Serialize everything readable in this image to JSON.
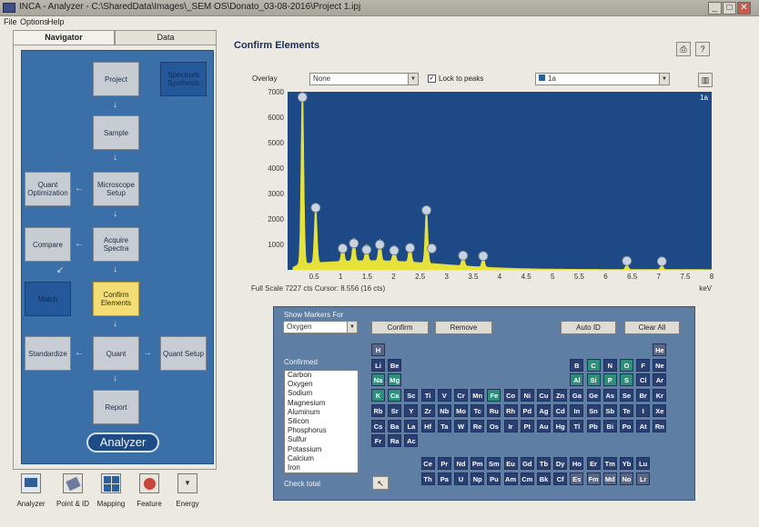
{
  "window": {
    "title": "INCA - Analyzer - C:\\SharedData\\Images\\_SEM OS\\Donato_03-08-2016\\Project 1.ipj"
  },
  "menu": [
    "File",
    "Options",
    "Help"
  ],
  "nav": {
    "tabs": [
      "Navigator",
      "Data"
    ],
    "boxes": {
      "project": "Project",
      "spectrum_synthesis": "Spectrum Synthesis",
      "sample": "Sample",
      "quant_optimization": "Quant Optimization",
      "microscope_setup": "Microscope Setup",
      "compare": "Compare",
      "acquire_spectra": "Acquire Spectra",
      "match": "Match",
      "confirm_elements": "Confirm Elements",
      "standardize": "Standardize",
      "quant": "Quant",
      "quant_setup": "Quant Setup",
      "report": "Report"
    },
    "analyzer_button": "Analyzer"
  },
  "toolbar": [
    {
      "label": "Analyzer",
      "icon": "analyzer-icon"
    },
    {
      "label": "Point & ID",
      "icon": "point-id-icon"
    },
    {
      "label": "Mapping",
      "icon": "mapping-icon"
    },
    {
      "label": "Feature",
      "icon": "feature-icon"
    },
    {
      "label": "Energy",
      "icon": "energy-icon"
    }
  ],
  "main": {
    "title": "Confirm Elements",
    "overlay_label": "Overlay",
    "overlay_value": "None",
    "lock_to_peaks": "Lock to peaks",
    "lock_checked": true,
    "spectrum_select": "1a",
    "spectrum_name": "1a",
    "full_scale": "Full Scale 7227 cts Cursor: 8.556 (16 cts)"
  },
  "chart_data": {
    "type": "line",
    "xlabel": "keV",
    "ylim": [
      0,
      7000
    ],
    "xlim": [
      0,
      8
    ],
    "yticks": [
      1000,
      2000,
      3000,
      4000,
      5000,
      6000,
      7000
    ],
    "xticks": [
      "0.5",
      "1",
      "1.5",
      "2",
      "2.5",
      "3",
      "3.5",
      "4",
      "4.5",
      "5",
      "5.5",
      "6",
      "6.5",
      "7",
      "7.5",
      "8"
    ],
    "peaks": [
      {
        "x": 0.28,
        "y": 7227
      },
      {
        "x": 0.53,
        "y": 2300
      },
      {
        "x": 1.04,
        "y": 700
      },
      {
        "x": 1.25,
        "y": 900
      },
      {
        "x": 1.49,
        "y": 650
      },
      {
        "x": 1.74,
        "y": 850
      },
      {
        "x": 2.01,
        "y": 620
      },
      {
        "x": 2.31,
        "y": 720
      },
      {
        "x": 2.62,
        "y": 2200
      },
      {
        "x": 3.31,
        "y": 420
      },
      {
        "x": 3.69,
        "y": 400
      },
      {
        "x": 6.4,
        "y": 210
      },
      {
        "x": 7.06,
        "y": 190
      }
    ],
    "markers": [
      0.28,
      0.53,
      1.04,
      1.25,
      1.49,
      1.74,
      2.01,
      2.31,
      2.62,
      2.72,
      3.31,
      3.69,
      6.4,
      7.06
    ],
    "color": "#e6e23a",
    "background": "#1d4a86"
  },
  "picker": {
    "show_markers_for": "Show Markers For",
    "element_select": "Oxygen",
    "confirm": "Confirm",
    "remove": "Remove",
    "auto_id": "Auto ID",
    "clear_all": "Clear All",
    "confirmed_label": "Confirmed",
    "confirmed": [
      "Carbon",
      "Oxygen",
      "Sodium",
      "Magnesium",
      "Aluminum",
      "Silicon",
      "Phosphorus",
      "Sulfur",
      "Potassium",
      "Calcium",
      "Iron"
    ],
    "check_total": "Check total",
    "periodic_rows": [
      [
        "H",
        "",
        "",
        "",
        "",
        "",
        "",
        "",
        "",
        "",
        "",
        "",
        "",
        "",
        "",
        "",
        "",
        "He"
      ],
      [
        "Li",
        "Be",
        "",
        "",
        "",
        "",
        "",
        "",
        "",
        "",
        "",
        "",
        "B",
        "C",
        "N",
        "O",
        "F",
        "Ne"
      ],
      [
        "Na",
        "Mg",
        "",
        "",
        "",
        "",
        "",
        "",
        "",
        "",
        "",
        "",
        "Al",
        "Si",
        "P",
        "S",
        "Cl",
        "Ar"
      ],
      [
        "K",
        "Ca",
        "Sc",
        "Ti",
        "V",
        "Cr",
        "Mn",
        "Fe",
        "Co",
        "Ni",
        "Cu",
        "Zn",
        "Ga",
        "Ge",
        "As",
        "Se",
        "Br",
        "Kr"
      ],
      [
        "Rb",
        "Sr",
        "Y",
        "Zr",
        "Nb",
        "Mo",
        "Tc",
        "Ru",
        "Rh",
        "Pd",
        "Ag",
        "Cd",
        "In",
        "Sn",
        "Sb",
        "Te",
        "I",
        "Xe"
      ],
      [
        "Cs",
        "Ba",
        "La",
        "Hf",
        "Ta",
        "W",
        "Re",
        "Os",
        "Ir",
        "Pt",
        "Au",
        "Hg",
        "Tl",
        "Pb",
        "Bi",
        "Po",
        "At",
        "Rn"
      ],
      [
        "Fr",
        "Ra",
        "Ac",
        "",
        "",
        "",
        "",
        "",
        "",
        "",
        "",
        "",
        "",
        "",
        "",
        "",
        "",
        ""
      ]
    ],
    "lanthanides": [
      "Ce",
      "Pr",
      "Nd",
      "Pm",
      "Sm",
      "Eu",
      "Gd",
      "Tb",
      "Dy",
      "Ho",
      "Er",
      "Tm",
      "Yb",
      "Lu"
    ],
    "actinides": [
      "Th",
      "Pa",
      "U",
      "Np",
      "Pu",
      "Am",
      "Cm",
      "Bk",
      "Cf",
      "Es",
      "Fm",
      "Md",
      "No",
      "Lr"
    ],
    "confirmed_symbols": [
      "C",
      "O",
      "Na",
      "Mg",
      "Al",
      "Si",
      "P",
      "S",
      "K",
      "Ca",
      "Fe"
    ],
    "dim_symbols": [
      "H",
      "He",
      "Es",
      "Fm",
      "Md",
      "No",
      "Lr"
    ],
    "colors": {
      "normal": "#2a3f74",
      "confirmed": "#2d8e7a",
      "dim": "#5a6684"
    }
  }
}
